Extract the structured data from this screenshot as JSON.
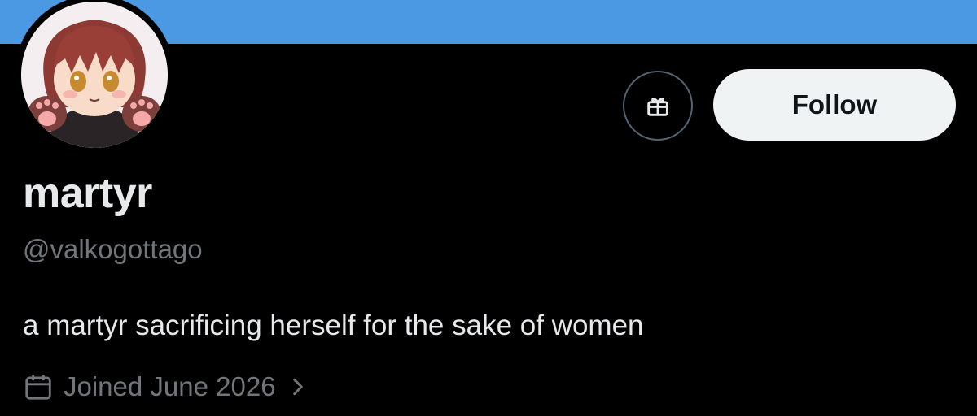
{
  "profile": {
    "display_name": "martyr",
    "handle": "@valkogottago",
    "bio": "a martyr sacrificing herself for the sake of women",
    "joined": "Joined June 2026"
  },
  "actions": {
    "follow_label": "Follow",
    "gift_icon": "gift-icon"
  },
  "icons": {
    "calendar": "calendar-icon",
    "chevron": "chevron-right-icon"
  },
  "colors": {
    "banner": "#4a99e2",
    "background": "#000000",
    "primary_text": "#e7e9ea",
    "secondary_text": "#71767b",
    "follow_bg": "#eff3f4"
  }
}
